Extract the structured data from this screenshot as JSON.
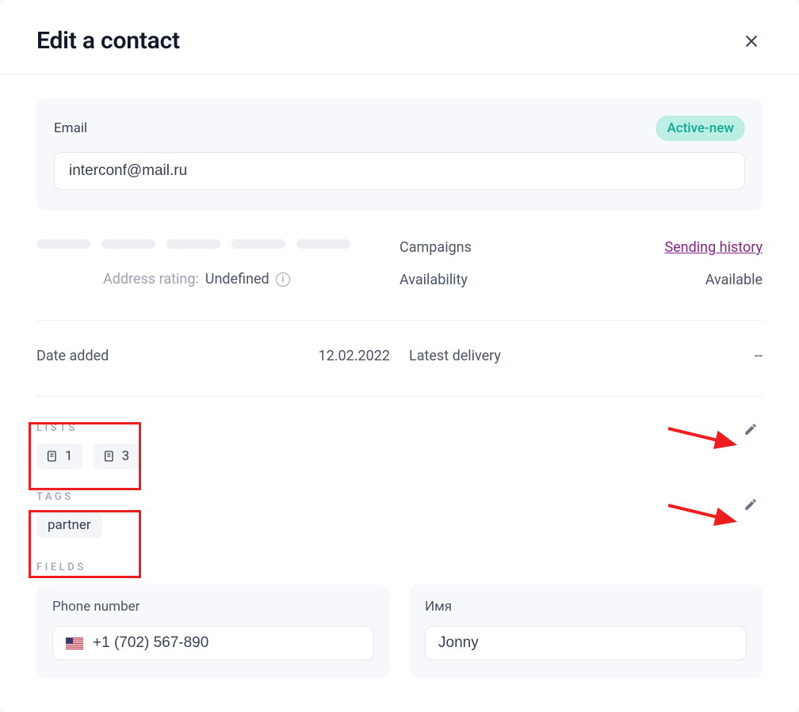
{
  "header": {
    "title": "Edit a contact"
  },
  "email": {
    "label": "Email",
    "value": "interconf@mail.ru",
    "status": "Active-new"
  },
  "rating": {
    "label": "Address rating:",
    "value": "Undefined"
  },
  "right_stats": {
    "campaigns_label": "Campaigns",
    "campaigns_value": "Sending history",
    "availability_label": "Availability",
    "availability_value": "Available"
  },
  "dates": {
    "added_label": "Date added",
    "added_value": "12.02.2022",
    "latest_label": "Latest delivery",
    "latest_value": "--"
  },
  "lists": {
    "heading": "LISTS",
    "items": [
      "1",
      "3"
    ]
  },
  "tags": {
    "heading": "TAGS",
    "items": [
      "partner"
    ]
  },
  "fields": {
    "heading": "FIELDS",
    "phone": {
      "label": "Phone number",
      "value": "+1 (702) 567-890"
    },
    "name": {
      "label": "Имя",
      "value": "Jonny"
    }
  }
}
